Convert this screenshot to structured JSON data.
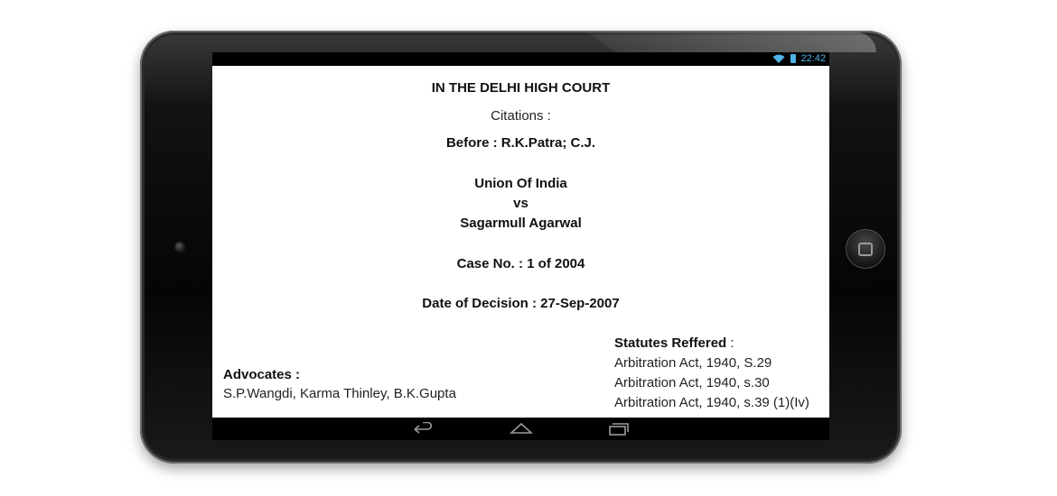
{
  "statusbar": {
    "time": "22:42"
  },
  "document": {
    "court": "IN THE DELHI HIGH COURT",
    "citations_label": "Citations :",
    "before": "Before : R.K.Patra; C.J.",
    "party1": "Union Of India",
    "vs": "vs",
    "party2": "Sagarmull Agarwal",
    "case_no": "Case No. : 1 of 2004",
    "date_of_decision": "Date of Decision : 27-Sep-2007",
    "advocates": {
      "label": "Advocates :",
      "names": "S.P.Wangdi, Karma Thinley, B.K.Gupta"
    },
    "statutes": {
      "label": "Statutes Reffered",
      "colon": " :",
      "items": [
        "Arbitration Act, 1940,  S.29",
        "Arbitration Act, 1940,  s.30",
        "Arbitration Act, 1940,  s.39 (1)(Iv)"
      ]
    }
  },
  "navbar": {
    "icons": [
      "back-icon",
      "home-icon",
      "recent-apps-icon"
    ]
  },
  "colors": {
    "status_accent": "#4fb3e8",
    "screen_bg": "#ffffff",
    "bezel": "#0a0a0a"
  }
}
